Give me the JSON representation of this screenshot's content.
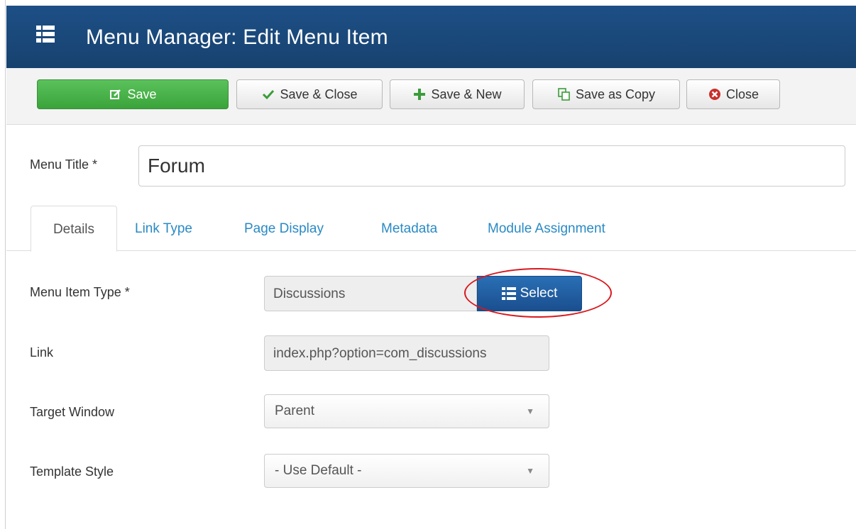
{
  "header": {
    "title": "Menu Manager: Edit Menu Item",
    "icon": "list-icon",
    "background": "#1d4f86"
  },
  "toolbar": {
    "save_label": "Save",
    "save_close_label": "Save & Close",
    "save_new_label": "Save & New",
    "save_copy_label": "Save as Copy",
    "close_label": "Close",
    "save_color": "#46b346"
  },
  "form": {
    "menu_title_label": "Menu Title *",
    "menu_title_value": "Forum",
    "menu_item_type_label": "Menu Item Type *",
    "menu_item_type_value": "Discussions",
    "select_label": "Select",
    "link_label": "Link",
    "link_value": "index.php?option=com_discussions",
    "target_window_label": "Target Window",
    "target_window_value": "Parent",
    "template_style_label": "Template Style",
    "template_style_value": "- Use Default -"
  },
  "tabs": [
    {
      "label": "Details",
      "active": true
    },
    {
      "label": "Link Type",
      "active": false
    },
    {
      "label": "Page Display",
      "active": false
    },
    {
      "label": "Metadata",
      "active": false
    },
    {
      "label": "Module Assignment",
      "active": false
    }
  ],
  "colors": {
    "link": "#2a8ac4",
    "select_button": "#1f5fa0",
    "annotation_circle": "#d8181f"
  }
}
